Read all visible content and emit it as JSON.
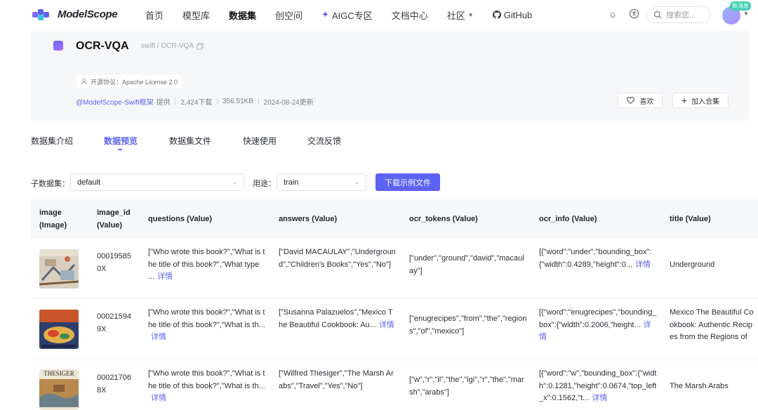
{
  "nav": {
    "logo_text": "ModelScope",
    "items": [
      "首页",
      "模型库",
      "数据集",
      "创空间",
      "AIGC专区",
      "文档中心",
      "社区",
      "GitHub"
    ],
    "search_placeholder": "搜索您...",
    "badge": "新消息"
  },
  "dataset": {
    "title": "OCR-VQA",
    "path": "swift / OCR-VQA",
    "license": "开源协议：Apache License 2.0",
    "owner": "@ModelScope-Swift框架",
    "provided": "提供",
    "downloads": "2,424下载",
    "size": "356.51KB",
    "updated": "2024-08-24更新",
    "like_label": "喜欢",
    "add_label": "加入合集"
  },
  "tabs": [
    "数据集介绍",
    "数据预览",
    "数据集文件",
    "快速使用",
    "交流反馈"
  ],
  "filters": {
    "subset_label": "子数据集：",
    "subset_value": "default",
    "split_label": "用途：",
    "split_value": "train",
    "download_button": "下载示例文件"
  },
  "table": {
    "headers": [
      [
        "image",
        "(Image)"
      ],
      [
        "image_id",
        "(Value)"
      ],
      [
        "questions (Value)"
      ],
      [
        "answers (Value)"
      ],
      [
        "ocr_tokens (Value)"
      ],
      [
        "ocr_info (Value)"
      ],
      [
        "title (Value)"
      ]
    ],
    "more_label": "详情",
    "rows": [
      {
        "image_id": "000195850X",
        "questions": "[\"Who wrote this book?\",\"What is the title of this book?\",\"What type ...",
        "answers": "[\"David MACAULAY\",\"Underground\",\"Children's Books\",\"Yes\",\"No\"]",
        "ocr_tokens": "[\"under\",\"ground\",\"david\",\"macaulay\"]",
        "ocr_info": "[{\"word\":\"under\",\"bounding_box\":{\"width\":0.4289,\"height\":0...",
        "title": "Underground"
      },
      {
        "image_id": "000215949X",
        "questions": "[\"Who wrote this book?\",\"What is the title of this book?\",\"What is th...",
        "answers": "[\"Susanna Palazuelos\",\"Mexico The Beautiful Cookbook: Au...",
        "ocr_tokens": "[\"enugrecipes\",\"from\",\"the\",\"regions\",\"of\",\"mexico\"]",
        "ocr_info": "[{\"word\":\"enugrecipes\",\"bounding_box\":{\"width\":0.2006,\"height...",
        "title": "Mexico The Beautiful Cookbook: Authentic Recipes from the Regions of Mexico"
      },
      {
        "image_id": "000217068X",
        "questions": "[\"Who wrote this book?\",\"What is the title of this book?\",\"What is th...",
        "answers": "[\"Wilfred Thesiger\",\"The Marsh Arabs\",\"Travel\",\"Yes\",\"No\"]",
        "ocr_tokens": "[\"w\",\"r\",\"il\",\"the\",\"igi\",\"r\",\"the\",\"marsh\",\"arabs\"]",
        "ocr_info": "[{\"word\":\"w\",\"bounding_box\":{\"width\":0.1281,\"height\":0.0674,\"top_left_x\":0.1562,\"t...",
        "title": "The Marsh Arabs",
        "cover_text": "THESIGER"
      }
    ]
  },
  "colors": {
    "accent": "#5c62f2",
    "header_bg": "#f6f7f9"
  }
}
